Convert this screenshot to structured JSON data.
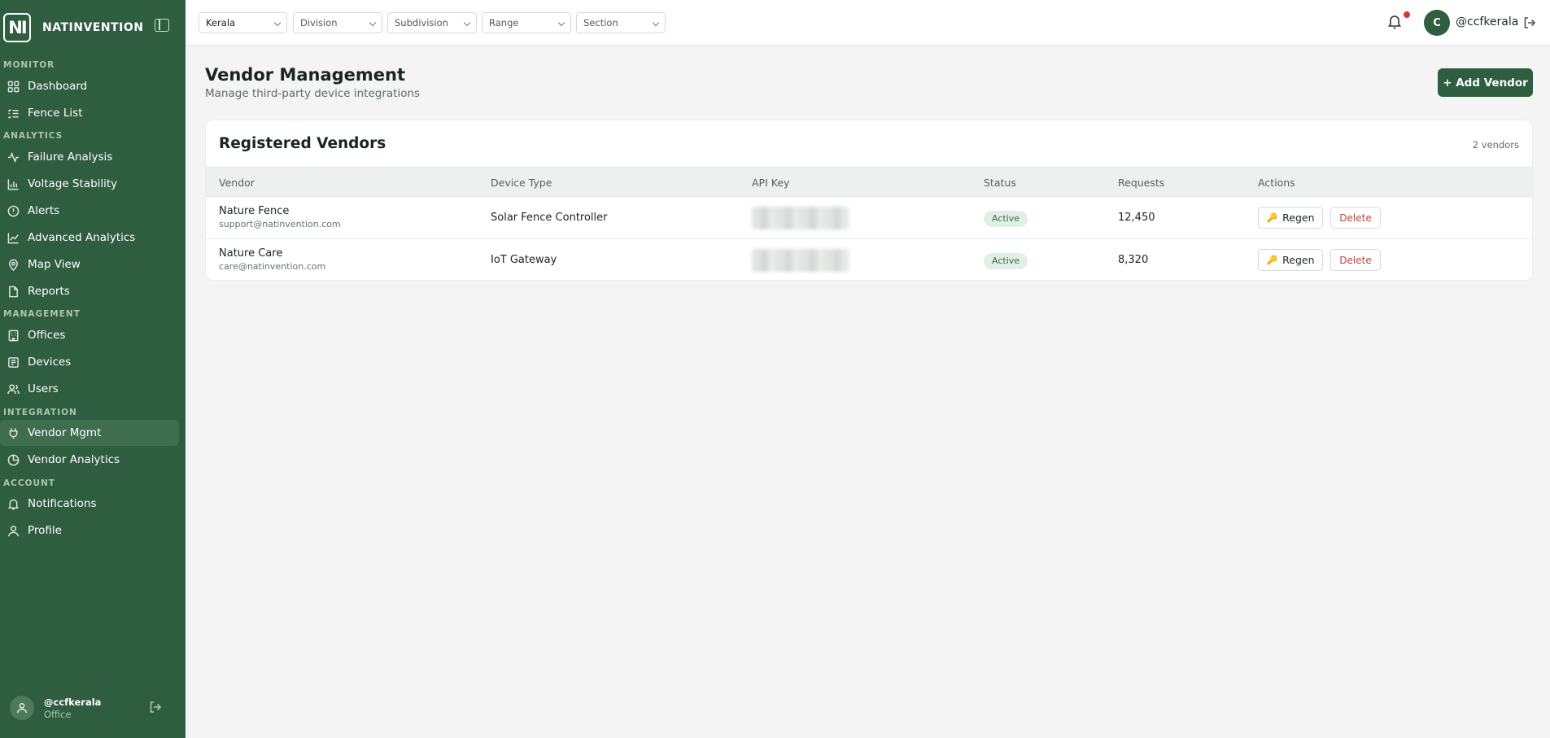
{
  "app": {
    "brand_short": "NI",
    "brand_name": "NATINVENTION"
  },
  "sidebar": {
    "sections": {
      "monitor": "MONITOR",
      "analytics": "ANALYTICS",
      "management": "MANAGEMENT",
      "integration": "INTEGRATION",
      "account": "ACCOUNT"
    },
    "items": {
      "dashboard": "Dashboard",
      "fence_list": "Fence List",
      "failure_analysis": "Failure Analysis",
      "voltage_stability": "Voltage Stability",
      "alerts": "Alerts",
      "advanced_analytics": "Advanced Analytics",
      "map_view": "Map View",
      "reports": "Reports",
      "offices": "Offices",
      "devices": "Devices",
      "users": "Users",
      "vendor_mgmt": "Vendor Mgmt",
      "vendor_analytics": "Vendor Analytics",
      "notifications": "Notifications",
      "profile": "Profile"
    },
    "active_item": "vendor_mgmt",
    "user": {
      "name": "@ccfkerala",
      "role": "Office"
    }
  },
  "topbar": {
    "filters": {
      "state": "Kerala",
      "division": "Division",
      "subdivision": "Subdivision",
      "range": "Range",
      "section": "Section"
    },
    "avatar_initial": "C",
    "username": "@ccfkerala",
    "notification_dot_color": "#d8382c"
  },
  "main": {
    "title": "Vendor Management",
    "subtitle": "Manage third-party device integrations",
    "add_button": "+ Add Vendor",
    "card": {
      "title": "Registered Vendors",
      "count": "2 vendors",
      "columns": {
        "vendor": "Vendor",
        "device_type": "Device Type",
        "api_key": "API Key",
        "status": "Status",
        "requests": "Requests",
        "actions": "Actions"
      },
      "rows": [
        {
          "name": "Nature Fence",
          "email": "support@natinvention.com",
          "device_type": "Solar Fence Controller",
          "status": "Active",
          "requests": "12,450",
          "regen": "Regen",
          "delete": "Delete"
        },
        {
          "name": "Nature Care",
          "email": "care@natinvention.com",
          "device_type": "IoT Gateway",
          "status": "Active",
          "requests": "8,320",
          "regen": "Regen",
          "delete": "Delete"
        }
      ]
    }
  },
  "colors": {
    "brand": "#2f5d3f",
    "active_nav": "#3f6e4f",
    "status_active_bg": "#e2efe5",
    "delete_text": "#b84a3e"
  }
}
